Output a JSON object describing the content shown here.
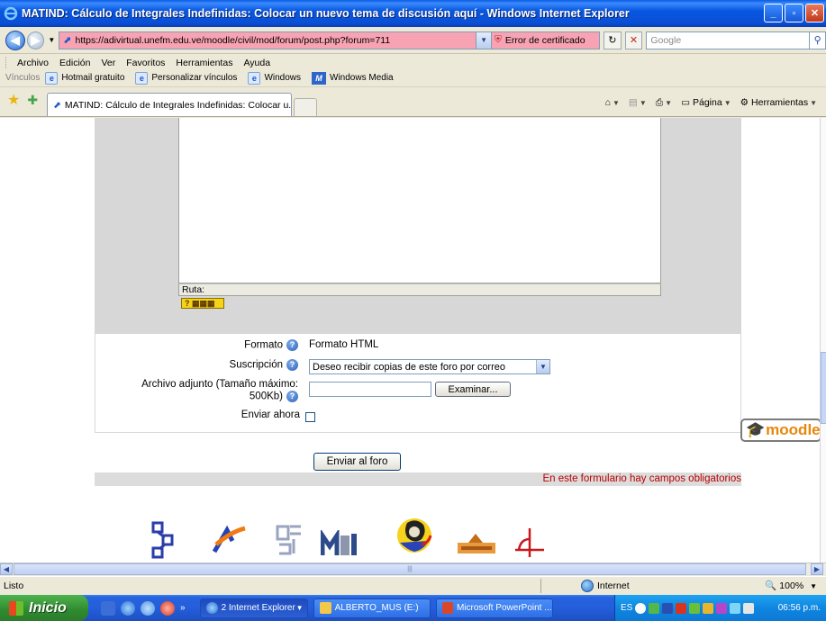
{
  "window": {
    "title": "MATIND: Cálculo de Integrales Indefinidas: Colocar un nuevo tema de discusión aquí - Windows Internet Explorer",
    "buttons": [
      "minimize-icon",
      "maximize-icon",
      "close-icon"
    ]
  },
  "address": {
    "url": "https://adivirtual.unefm.edu.ve/moodle/civil/mod/forum/post.php?forum=711",
    "cert_error": "Error de certificado",
    "search_placeholder": "Google"
  },
  "menu": {
    "items": [
      "Archivo",
      "Edición",
      "Ver",
      "Favoritos",
      "Herramientas",
      "Ayuda"
    ]
  },
  "links": {
    "label": "Vínculos",
    "items": [
      "Hotmail gratuito",
      "Personalizar vínculos",
      "Windows",
      "Windows Media"
    ]
  },
  "tabs": {
    "active_label": "MATIND: Cálculo de Integrales Indefinidas: Colocar u...",
    "commands": {
      "page": "Página",
      "tools": "Herramientas"
    }
  },
  "editor": {
    "path_label": "Ruta:"
  },
  "form": {
    "format_label": "Formato",
    "format_value": "Formato HTML",
    "subscription_label": "Suscripción",
    "subscription_value": "Deseo recibir copias de este foro por correo",
    "attachment_label": "Archivo adjunto (Tamaño máximo: 500Kb)",
    "attachment_label_line1": "Archivo adjunto (Tamaño máximo:",
    "attachment_label_line2": "500Kb)",
    "browse_label": "Examinar...",
    "send_now_label": "Enviar ahora",
    "send_now_checked": false,
    "submit_label": "Enviar al foro",
    "required_note": "En este formulario hay campos obligatorios"
  },
  "footer": {
    "moodle_logo_text": "moodle"
  },
  "status": {
    "text": "Listo",
    "zone": "Internet",
    "zoom": "100%"
  },
  "taskbar": {
    "start_label": "Inicio",
    "tasks": [
      "2 Internet Explorer",
      "ALBERTO_MUS (E:)",
      "Microsoft PowerPoint ..."
    ],
    "lang": "ES",
    "clock": "06:56 p.m."
  },
  "colors": {
    "cert_error_bg": "#f7a3b3",
    "required_text": "#b80000",
    "editor_panel": "#d7d7d7"
  }
}
